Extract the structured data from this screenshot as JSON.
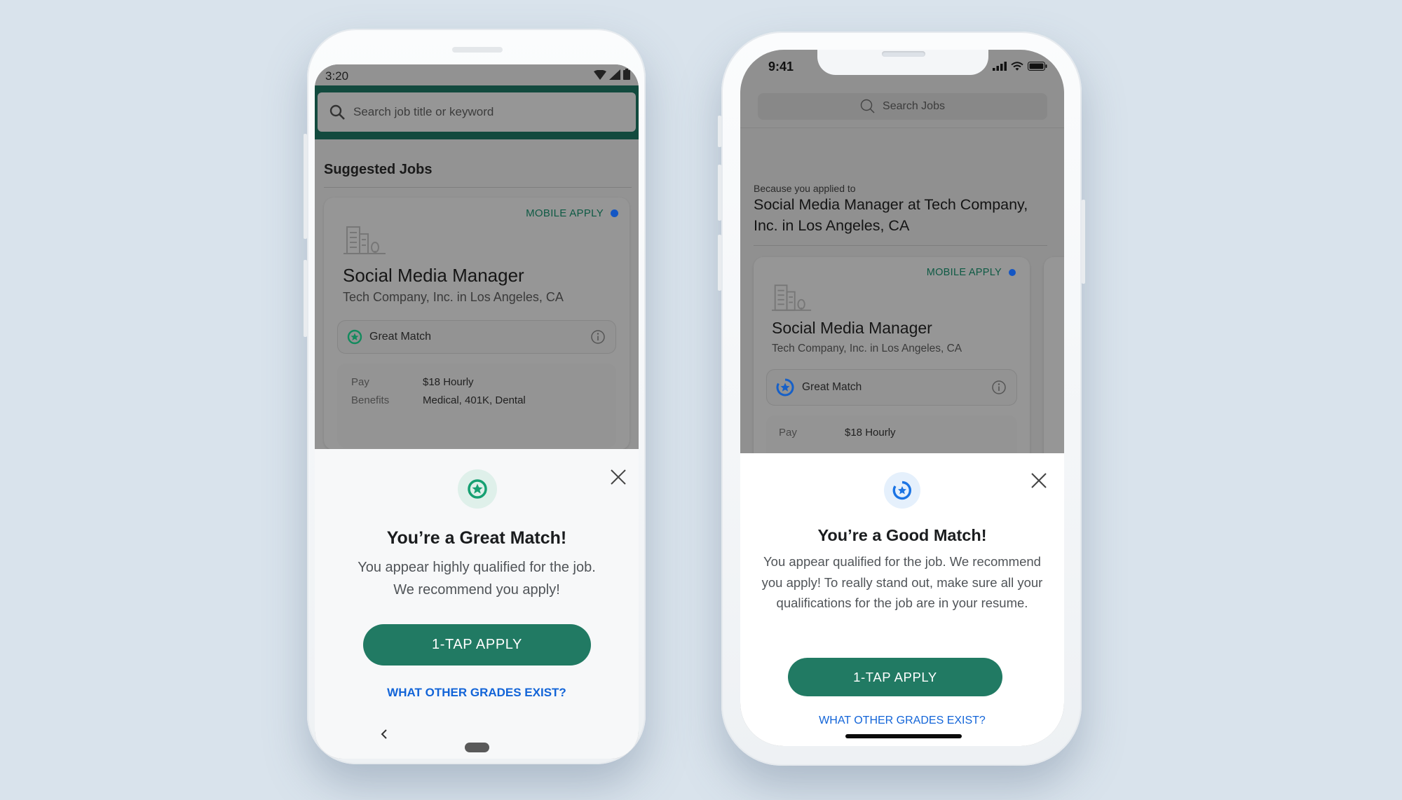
{
  "android": {
    "status_time": "3:20",
    "status_icons": [
      "wifi-icon",
      "signal-icon",
      "battery-icon"
    ],
    "search_placeholder": "Search job title or keyword",
    "section_title": "Suggested Jobs",
    "card": {
      "badge": "MOBILE APPLY",
      "title": "Social Media Manager",
      "company_location": "Tech Company, Inc. in Los Angeles, CA",
      "match_label": "Great Match",
      "details": [
        {
          "key": "Pay",
          "value": "$18 Hourly"
        },
        {
          "key": "Benefits",
          "value": "Medical, 401K, Dental"
        }
      ]
    },
    "sheet": {
      "title": "You’re a Great Match!",
      "body_line1": "You appear highly qualified for the job.",
      "body_line2": "We recommend you apply!",
      "apply_button": "1-TAP APPLY",
      "grades_link": "WHAT OTHER GRADES EXIST?"
    }
  },
  "iphone": {
    "status_time": "9:41",
    "status_icons": [
      "signal-icon",
      "wifi-icon",
      "battery-icon"
    ],
    "search_placeholder": "Search Jobs",
    "because_label": "Because you applied to",
    "applied_job": "Social Media Manager at Tech Company, Inc. in Los Angeles, CA",
    "card": {
      "badge": "MOBILE APPLY",
      "title": "Social Media Manager",
      "company_location": "Tech Company, Inc. in Los Angeles, CA",
      "match_label": "Great Match",
      "details": [
        {
          "key": "Pay",
          "value": "$18 Hourly"
        }
      ]
    },
    "sheet": {
      "title": "You’re a Good Match!",
      "body": "You appear qualified for the job. We recommend you apply! To really stand out, make sure all your qualifications for the job are in your resume.",
      "apply_button": "1-TAP APPLY",
      "grades_link": "WHAT OTHER GRADES EXIST?"
    }
  },
  "colors": {
    "brand_green": "#217a63",
    "header_green": "#124a3e",
    "great_match_green": "#1a9a6c",
    "good_match_blue": "#1b74e4",
    "link_blue": "#1264d8",
    "mobile_apply_dot": "#1356c4",
    "background": "#d9e3ec"
  }
}
